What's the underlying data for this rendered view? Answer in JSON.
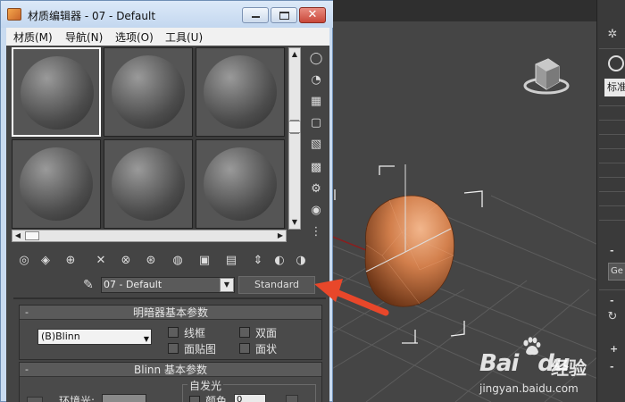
{
  "window": {
    "title": "材质编辑器 - 07 - Default",
    "close_glyph": "✕"
  },
  "menu": {
    "items": [
      {
        "label": "材质(M)"
      },
      {
        "label": "导航(N)"
      },
      {
        "label": "选项(O)"
      },
      {
        "label": "工具(U)"
      }
    ]
  },
  "slots": {
    "count": 6,
    "active_index": 0
  },
  "material": {
    "name": "07 - Default",
    "type_label": "Standard"
  },
  "shader_rollout": {
    "title": "明暗器基本参数",
    "shader": "(B)Blinn",
    "options": [
      {
        "label": "线框",
        "checked": false
      },
      {
        "label": "双面",
        "checked": false
      },
      {
        "label": "面贴图",
        "checked": false
      },
      {
        "label": "面状",
        "checked": false
      }
    ]
  },
  "blinn_rollout": {
    "title": "Blinn 基本参数",
    "self_illum_label": "自发光",
    "ambient_label": "环境光:",
    "color_label": "颜色",
    "color_value": "0"
  },
  "right_panel": {
    "field_text": "标准"
  },
  "watermark": {
    "bai_text": "Bai",
    "du_text": "du",
    "jingyan_text": "经验",
    "url": "jingyan.baidu.com"
  },
  "colors": {
    "arrow": "#e8472a",
    "sphere": "#d98a5a",
    "viewport_bg": "#454545"
  }
}
